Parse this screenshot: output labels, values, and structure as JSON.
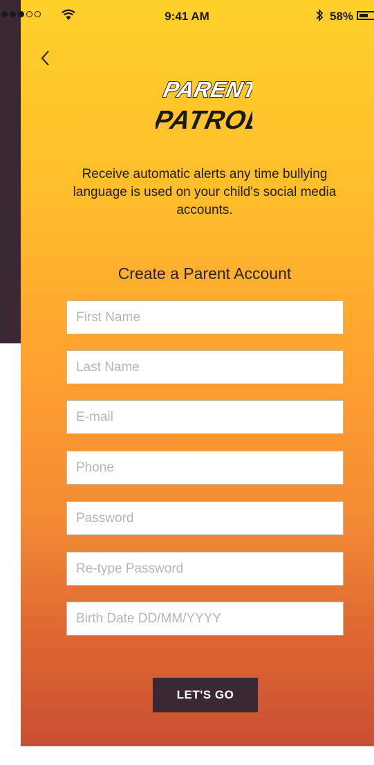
{
  "status_bar": {
    "time": "9:41 AM",
    "battery": "58%",
    "signal_icon": "signal-dots-icon",
    "wifi_icon": "wifi-icon",
    "bluetooth_icon": "bluetooth-icon",
    "battery_icon": "battery-icon"
  },
  "nav": {
    "back_icon": "chevron-left-icon"
  },
  "logo": {
    "line1": "PARENT",
    "line2": "PATROL"
  },
  "tagline": "Receive automatic alerts any time bullying language is used on your child's social media accounts.",
  "form": {
    "title": "Create a Parent Account",
    "fields": {
      "first_name": {
        "placeholder": "First Name",
        "value": ""
      },
      "last_name": {
        "placeholder": "Last Name",
        "value": ""
      },
      "email": {
        "placeholder": "E-mail",
        "value": ""
      },
      "phone": {
        "placeholder": "Phone",
        "value": ""
      },
      "password": {
        "placeholder": "Password",
        "value": ""
      },
      "retype_password": {
        "placeholder": "Re-type Password",
        "value": ""
      },
      "birth_date": {
        "placeholder": "Birth Date DD/MM/YYYY",
        "value": ""
      }
    },
    "submit_label": "LET'S GO"
  },
  "colors": {
    "gradient_top": "#ffd02a",
    "gradient_bottom": "#c94f33",
    "dark": "#3a2934",
    "text": "#1c1c1c"
  }
}
